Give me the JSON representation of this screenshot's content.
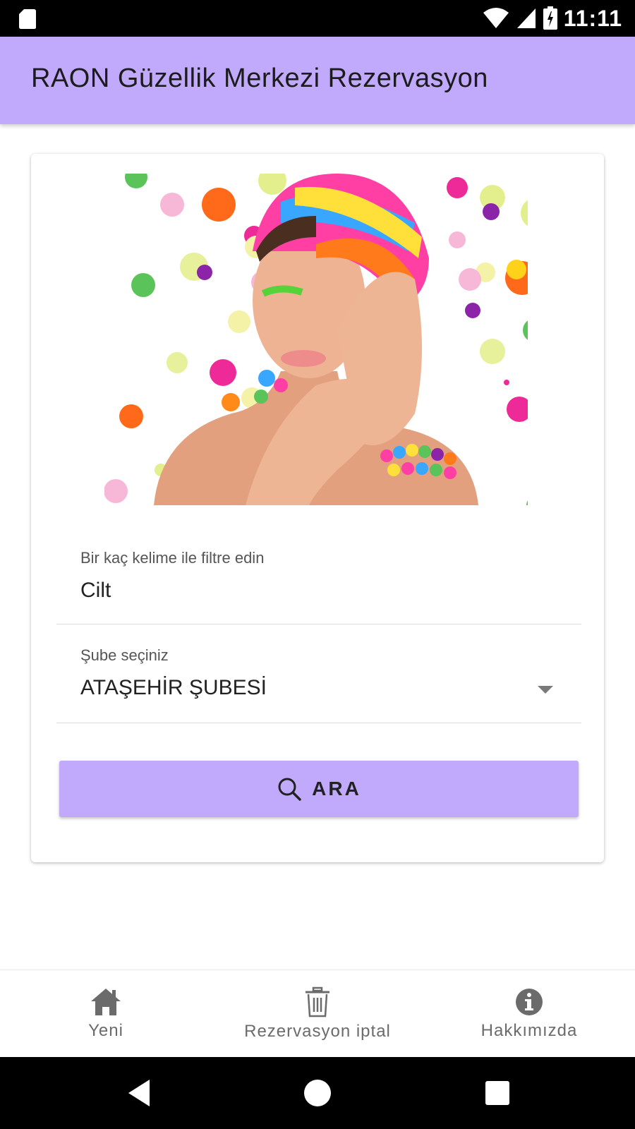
{
  "status_bar": {
    "time": "11:11",
    "icons": [
      "sd-card-icon",
      "wifi-icon",
      "signal-icon",
      "battery-icon"
    ]
  },
  "app_bar": {
    "title": "RAON Güzellik Merkezi Rezervasyon",
    "background_color": "#c1a9fb"
  },
  "search_card": {
    "hero_image": "colorful-beauty-woman-image",
    "keyword_field": {
      "label": "Bir kaç kelime ile filtre edin",
      "value": "Cilt"
    },
    "branch_select": {
      "label": "Şube seçiniz",
      "selected": "ATAŞEHİR ŞUBESİ"
    },
    "search_button": {
      "label": "ARA",
      "icon": "search-icon"
    }
  },
  "bottom_nav": {
    "items": [
      {
        "label": "Yeni",
        "icon": "home-icon"
      },
      {
        "label": "Rezervasyon iptal",
        "icon": "trash-icon"
      },
      {
        "label": "Hakkımızda",
        "icon": "info-icon"
      }
    ]
  },
  "system_nav": {
    "buttons": [
      "back-icon",
      "home-circle-icon",
      "recents-icon"
    ]
  }
}
